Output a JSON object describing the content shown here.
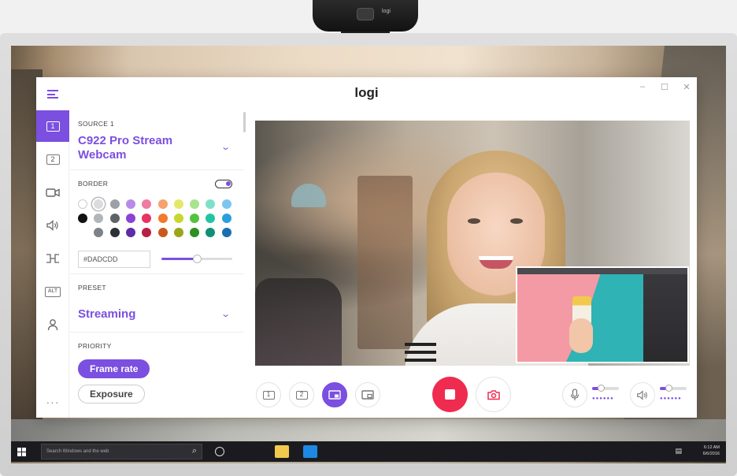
{
  "app": {
    "title": "logi",
    "window_controls": [
      "–",
      "☐",
      "✕"
    ],
    "accent_color": "#7b4fe0"
  },
  "rail": {
    "items": [
      {
        "label": "1",
        "icon": "source-1-icon",
        "active": true
      },
      {
        "label": "2",
        "icon": "source-2-icon",
        "active": false
      },
      {
        "label": "",
        "icon": "camera-icon",
        "active": false
      },
      {
        "label": "",
        "icon": "speaker-icon",
        "active": false
      },
      {
        "label": "",
        "icon": "transition-icon",
        "active": false
      },
      {
        "label": "ALT",
        "icon": "alt-icon",
        "active": false
      },
      {
        "label": "",
        "icon": "user-icon",
        "active": false
      },
      {
        "label": "···",
        "icon": "more-icon",
        "active": false
      }
    ]
  },
  "source": {
    "label": "SOURCE 1",
    "name": "C922 Pro Stream Webcam"
  },
  "border": {
    "label": "BORDER",
    "enabled": true,
    "hex_value": "#DADCDD",
    "opacity_fraction": 0.5,
    "selected_swatch": "#dadcdd",
    "swatches": [
      [
        "#ffffff",
        "#dadcdd",
        "#9aa0a6",
        "#b98be8",
        "#f07aa0",
        "#f6a26e",
        "#e3e86a",
        "#a8e38e",
        "#7fe0c8",
        "#7cc6ef"
      ],
      [
        "#111111",
        "#b0b5ba",
        "#5f6368",
        "#8a43d6",
        "#e83363",
        "#f07a2f",
        "#c9d62e",
        "#54c23e",
        "#22c4a3",
        "#2a9ee0"
      ],
      [
        "",
        "#7d8288",
        "#2d3034",
        "#5e2ca8",
        "#b81f45",
        "#c8591c",
        "#9aa51a",
        "#2f8f22",
        "#0f8f76",
        "#1a6fb0"
      ]
    ]
  },
  "preset": {
    "label": "PRESET",
    "value": "Streaming"
  },
  "priority": {
    "label": "PRIORITY",
    "options": [
      {
        "label": "Frame rate",
        "selected": true
      },
      {
        "label": "Exposure",
        "selected": false
      }
    ]
  },
  "controls": {
    "layout_buttons": [
      {
        "label": "1",
        "name": "layout-source-1-button",
        "active": false
      },
      {
        "label": "2",
        "name": "layout-source-2-button",
        "active": false
      },
      {
        "label": "▪",
        "name": "layout-pip-button",
        "active": true
      },
      {
        "label": "▪",
        "name": "layout-pip-alt-button",
        "active": false
      }
    ],
    "record_color": "#ef2b50",
    "mic_level": 0.3,
    "speaker_level": 0.3
  },
  "taskbar": {
    "search_placeholder": "Search Windows and the web",
    "time": "6:12 AM",
    "date": "6/6/2016"
  },
  "webcam": {
    "brand": "logi"
  }
}
